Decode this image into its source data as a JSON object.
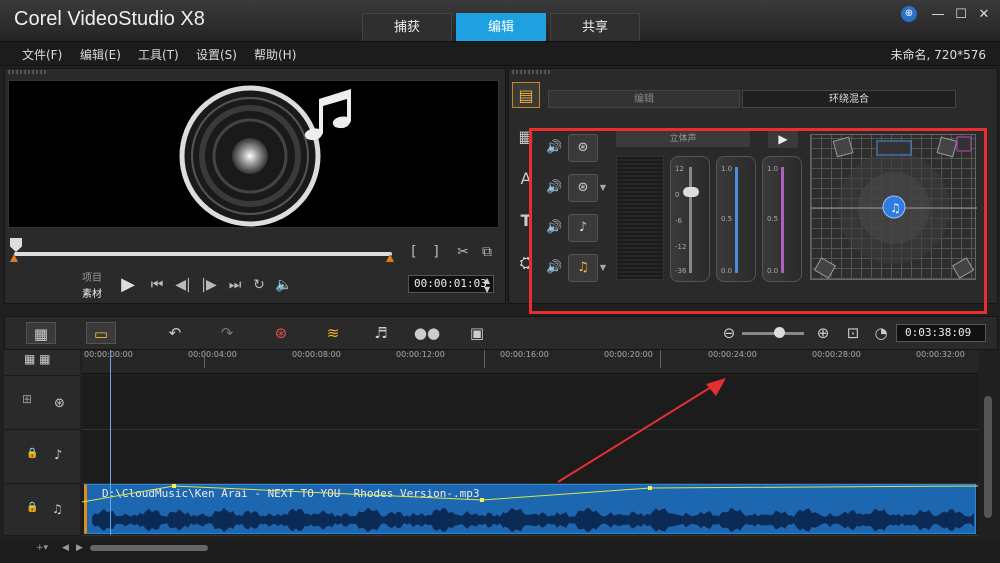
{
  "app": {
    "title": "Corel VideoStudio X8"
  },
  "main_tabs": [
    {
      "label": "捕获",
      "active": false
    },
    {
      "label": "编辑",
      "active": true
    },
    {
      "label": "共享",
      "active": false
    }
  ],
  "menu": [
    {
      "label": "文件(F)"
    },
    {
      "label": "编辑(E)"
    },
    {
      "label": "工具(T)"
    },
    {
      "label": "设置(S)"
    },
    {
      "label": "帮助(H)"
    }
  ],
  "project_info": "未命名, 720*576",
  "preview": {
    "mode_project": "项目",
    "mode_clip": "素材",
    "timecode": "00:00:01:03"
  },
  "options": {
    "tabs": [
      {
        "label": "编辑",
        "active": false
      },
      {
        "label": "环绕混合",
        "active": true
      }
    ],
    "stereo_label": "立体声",
    "fader1_ticks": [
      "12",
      "0",
      "-6",
      "-12",
      "-36"
    ],
    "fader2_ticks": [
      "1.0",
      "0.5",
      "0.0"
    ],
    "fader3_ticks": [
      "1.0",
      "0.5",
      "0.0"
    ]
  },
  "timeline": {
    "duration": "0:03:38:09",
    "ruler_ticks": [
      "00:00:00:00",
      "00:00:04:00",
      "00:00:08:00",
      "00:00:12:00",
      "00:00:16:00",
      "00:00:20:00",
      "00:00:24:00",
      "00:00:28:00",
      "00:00:32:00"
    ],
    "audio_clip_label": "D:\\CloudMusic\\Ken Arai - NEXT TO YOU -Rhodes Version-.mp3"
  },
  "colors": {
    "accent": "#1fa0e0",
    "annotation": "#e63030",
    "audio_clip": "#1d66b0"
  }
}
